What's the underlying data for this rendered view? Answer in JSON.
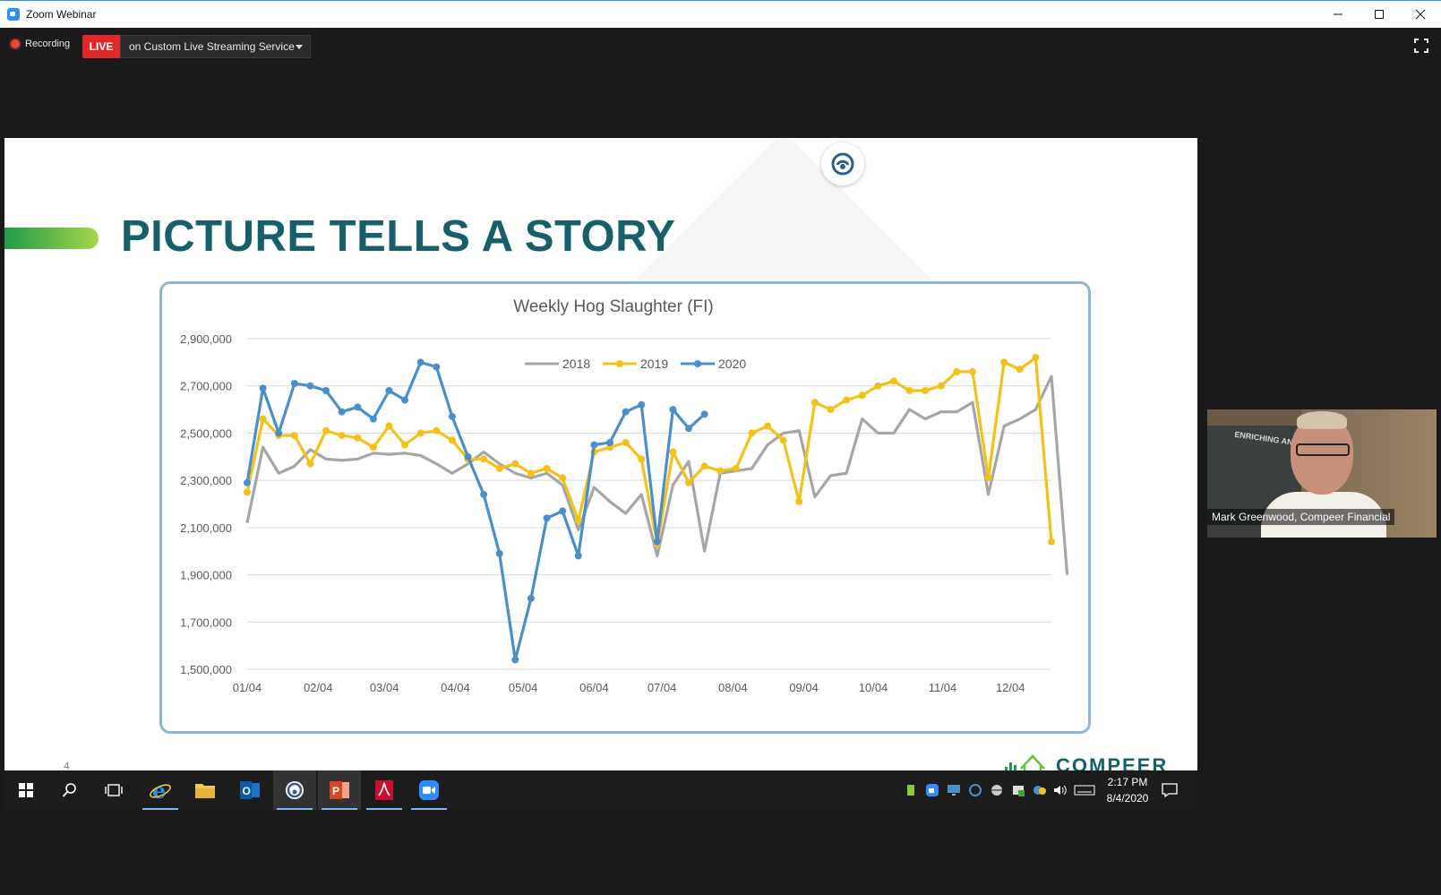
{
  "window": {
    "title": "Zoom Webinar"
  },
  "topbar": {
    "recording_label": "Recording",
    "live_label": "LIVE",
    "stream_service": "on Custom Live Streaming Service"
  },
  "slide": {
    "title": "PICTURE TELLS A STORY",
    "page_number": "4",
    "brand": "COMPEER"
  },
  "participant": {
    "name": "Mark Greenwood, Compeer Financial",
    "poster_text": "ENRICHING AND RURAL"
  },
  "taskbar": {
    "apps": [
      "start-icon",
      "search-icon",
      "task-view-icon",
      "internet-explorer-icon",
      "file-explorer-icon",
      "outlook-icon",
      "webinar-app-icon",
      "powerpoint-icon",
      "acrobat-icon",
      "zoom-icon"
    ],
    "time": "2:17 PM",
    "date": "8/4/2020"
  },
  "colors": {
    "s2018": "#a6a6a6",
    "s2019": "#f2c21b",
    "s2020": "#4a8fca",
    "title": "#17606a"
  },
  "chart_data": {
    "type": "line",
    "title": "Weekly Hog Slaughter (FI)",
    "xlabel": "",
    "ylabel": "",
    "ylim": [
      1500000,
      2900000
    ],
    "yticks": [
      1500000,
      1700000,
      1900000,
      2100000,
      2300000,
      2500000,
      2700000,
      2900000
    ],
    "ytick_labels": [
      "1,500,000",
      "1,700,000",
      "1,900,000",
      "2,100,000",
      "2,300,000",
      "2,500,000",
      "2,700,000",
      "2,900,000"
    ],
    "xticks": [
      "01/04",
      "02/04",
      "03/04",
      "04/04",
      "05/04",
      "06/04",
      "07/04",
      "08/04",
      "09/04",
      "10/04",
      "11/04",
      "12/04"
    ],
    "xtick_weeks": [
      0,
      4.5,
      8.7,
      13.2,
      17.5,
      22,
      26.3,
      30.8,
      35.3,
      39.7,
      44.1,
      48.4
    ],
    "legend": "top-center",
    "grid": true,
    "series": [
      {
        "name": "2018",
        "markers": false,
        "values": [
          2120000,
          2440000,
          2330000,
          2360000,
          2430000,
          2390000,
          2385000,
          2390000,
          2415000,
          2410000,
          2415000,
          2405000,
          2370000,
          2330000,
          2370000,
          2420000,
          2370000,
          2330000,
          2310000,
          2330000,
          2280000,
          2090000,
          2270000,
          2210000,
          2160000,
          2240000,
          1980000,
          2280000,
          2380000,
          2000000,
          2330000,
          2340000,
          2350000,
          2450000,
          2500000,
          2510000,
          2230000,
          2320000,
          2330000,
          2560000,
          2500000,
          2500000,
          2600000,
          2560000,
          2590000,
          2590000,
          2630000,
          2240000,
          2530000,
          2560000,
          2600000,
          2740000,
          1900000
        ]
      },
      {
        "name": "2019",
        "markers": true,
        "values": [
          2250000,
          2560000,
          2490000,
          2490000,
          2370000,
          2510000,
          2490000,
          2480000,
          2440000,
          2530000,
          2450000,
          2500000,
          2510000,
          2470000,
          2390000,
          2390000,
          2350000,
          2370000,
          2330000,
          2350000,
          2310000,
          2130000,
          2420000,
          2440000,
          2460000,
          2390000,
          2030000,
          2420000,
          2290000,
          2360000,
          2340000,
          2350000,
          2500000,
          2530000,
          2470000,
          2210000,
          2630000,
          2600000,
          2640000,
          2660000,
          2700000,
          2720000,
          2680000,
          2680000,
          2700000,
          2760000,
          2760000,
          2310000,
          2800000,
          2770000,
          2820000,
          2040000
        ]
      },
      {
        "name": "2020",
        "markers": true,
        "values": [
          2290000,
          2690000,
          2500000,
          2710000,
          2700000,
          2680000,
          2590000,
          2610000,
          2560000,
          2680000,
          2640000,
          2800000,
          2780000,
          2570000,
          2400000,
          2240000,
          1990000,
          1540000,
          1800000,
          2140000,
          2170000,
          1980000,
          2450000,
          2460000,
          2590000,
          2620000,
          2040000,
          2600000,
          2520000,
          2580000
        ]
      }
    ]
  }
}
